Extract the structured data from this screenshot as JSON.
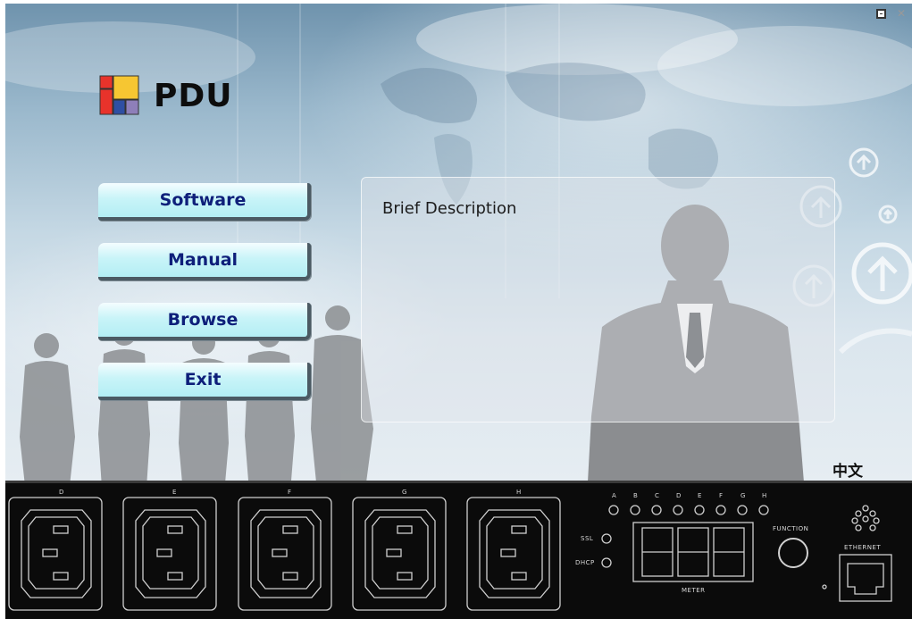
{
  "window": {
    "minimize_icon": "minimize-icon",
    "close_icon": "close-icon",
    "close_glyph": "✕"
  },
  "logo": {
    "text": "PDU",
    "icon": "colored-squares-logo-icon",
    "colors": {
      "red": "#e8332b",
      "yellow": "#f6c632",
      "blue": "#2f4fa3",
      "purple": "#8e7fb9"
    }
  },
  "menu": {
    "buttons": [
      {
        "id": "software",
        "label": "Software"
      },
      {
        "id": "manual",
        "label": "Manual"
      },
      {
        "id": "browse",
        "label": "Browse"
      },
      {
        "id": "exit",
        "label": "Exit"
      }
    ],
    "text_color": "#0e1f7a",
    "bg_color": "#c9f4f8"
  },
  "description": {
    "title": "Brief Description"
  },
  "language_toggle": "中文",
  "decor_icons": [
    "up-arrow-circle-icon"
  ],
  "device_panel": {
    "outlet_labels": [
      "D",
      "E",
      "F",
      "G",
      "H"
    ],
    "led_labels": [
      "A",
      "B",
      "C",
      "D",
      "E",
      "F",
      "G",
      "H"
    ],
    "status_labels": [
      "SSL",
      "DHCP"
    ],
    "meter_label": "METER",
    "function_label": "FUNCTION",
    "ethernet_label": "ETHERNET"
  }
}
